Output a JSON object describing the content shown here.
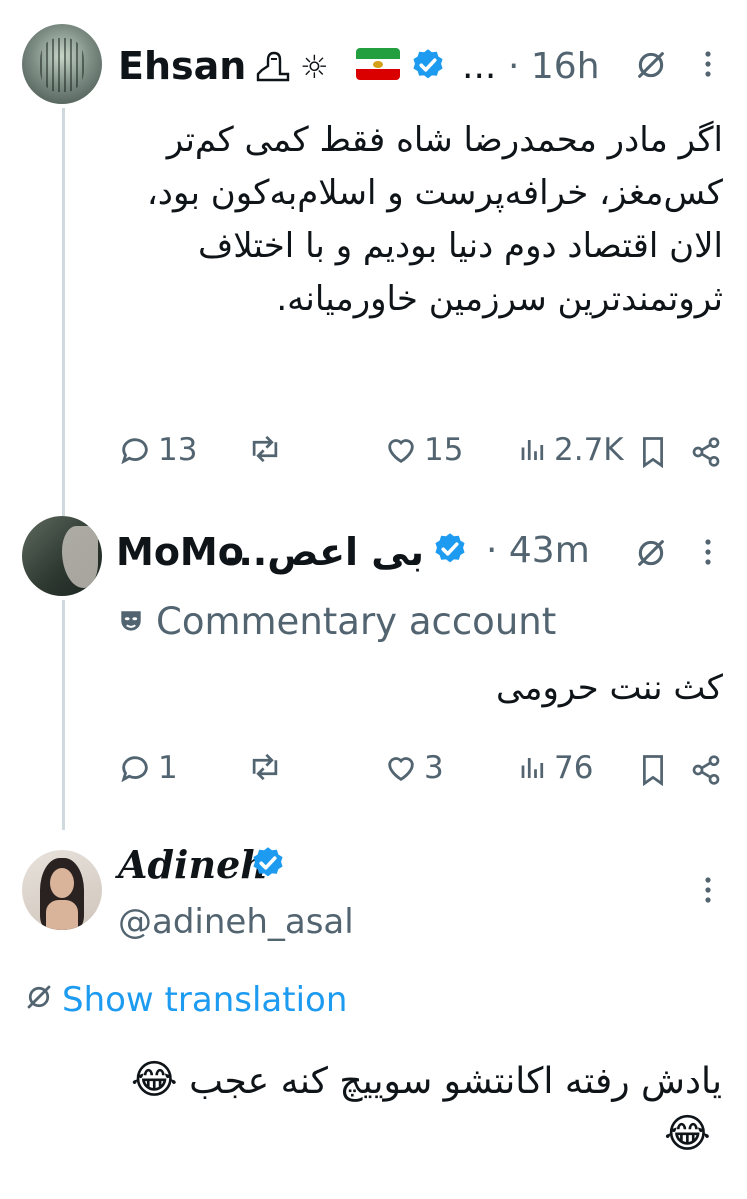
{
  "tweet1": {
    "display_name": "Ehsan",
    "emoji_tail": "☼",
    "ellipsis": "...",
    "time": "· 16h",
    "text": "اگر مادر محمدرضا شاه فقط کمی کم‌تر کس‌مغز، خرافه‌پرست و اسلام‌به‌کون بود، الان اقتصاد دوم دنیا بودیم و با اختلاف ثروتمندترین سرزمین خاورمیانه.",
    "replies": "13",
    "likes": "15",
    "views": "2.7K"
  },
  "tweet2": {
    "display_name": "MoMo",
    "name_rtl_part": "بی اعص...",
    "time": "· 43m",
    "label": "Commentary account",
    "text": "کث ننت حرومی",
    "replies": "1",
    "likes": "3",
    "views": "76"
  },
  "tweet3": {
    "display_name": "Adineh",
    "handle": "@adineh_asal",
    "translate_link": "Show translation",
    "text": "یادش رفته اکانتشو سوییچ کنه عجب",
    "emoji": "😂"
  },
  "colors": {
    "verified": "#1d9bf0",
    "link": "#1d9bf0",
    "secondary_text": "#536471"
  }
}
